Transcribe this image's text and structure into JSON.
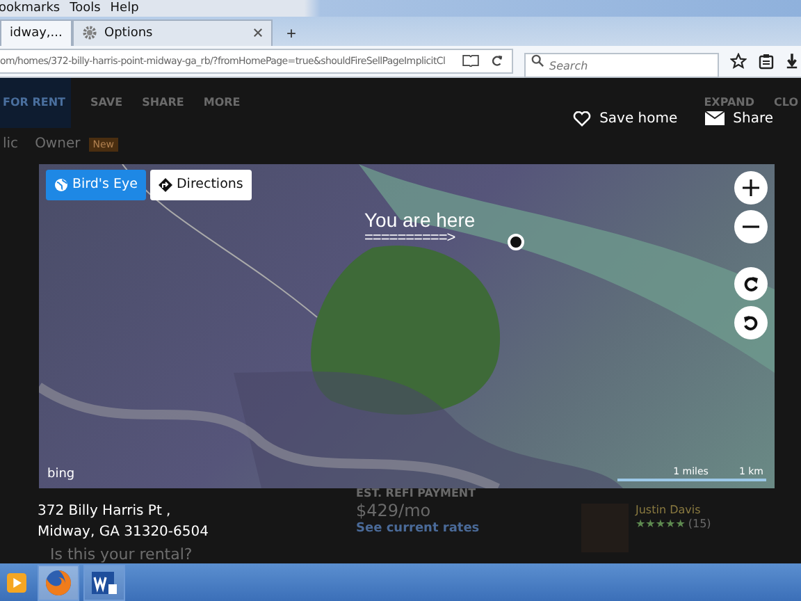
{
  "menu_bar": [
    "ookmarks",
    "Tools",
    "Help"
  ],
  "tabs": [
    {
      "label": "idway,...",
      "selected": true,
      "kind": "page"
    },
    {
      "label": "Options",
      "selected": false,
      "kind": "settings"
    }
  ],
  "new_tab": "+",
  "address_bar": {
    "url": "om/homes/372-billy-harris-point-midway-ga_rb/?fromHomePage=true&shouldFireSellPageImplicitCl",
    "search_placeholder": "Search"
  },
  "page_behind": {
    "badge_label": "FOR RENT",
    "actions": [
      "SAVE",
      "SHARE",
      "MORE"
    ],
    "expand": "EXPAND",
    "close": "CLO",
    "tabs": [
      {
        "label": "lic",
        "selected": false
      },
      {
        "label": "Owner",
        "selected": false
      }
    ],
    "owner_badge": "New",
    "rental_question": "Is this your rental?",
    "refi": {
      "heading": "EST. REFI PAYMENT",
      "amount": "$429/mo",
      "link": "See current rates"
    },
    "agent": {
      "name": "Justin Davis",
      "stars": 5,
      "count": "(15)"
    }
  },
  "overlay": {
    "save_home": "Save home",
    "share": "Share",
    "map": {
      "birds_eye": "Bird's Eye",
      "directions": "Directions",
      "annotation": "You are here",
      "annotation_arrow": "==========>",
      "provider": "bing",
      "scale_miles": "1 miles",
      "scale_km": "1 km"
    },
    "address": [
      "372 Billy Harris Pt ,",
      "Midway, GA 31320-6504"
    ]
  }
}
